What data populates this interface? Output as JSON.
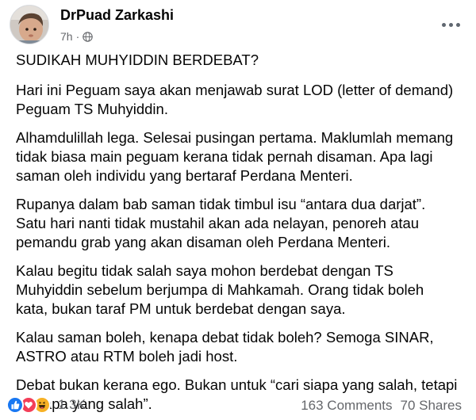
{
  "post": {
    "author": "DrPuad Zarkashi",
    "time": "7h",
    "privacy_icon": "globe-icon",
    "more_icon": "more-options-icon",
    "paragraphs": [
      "SUDIKAH MUHYIDDIN BERDEBAT?",
      "Hari ini Peguam saya akan menjawab surat LOD (letter of demand)\nPeguam TS Muhyiddin.",
      "Alhamdulillah lega. Selesai pusingan pertama. Maklumlah memang\ntidak biasa main peguam kerana tidak pernah disaman. Apa lagi\nsaman oleh individu yang bertaraf Perdana Menteri.",
      "Rupanya dalam bab saman tidak timbul isu “antara dua darjat”.\nSatu hari nanti tidak mustahil akan ada nelayan, penoreh atau\npemandu grab yang akan disaman oleh Perdana Menteri.",
      "Kalau begitu tidak salah saya mohon berdebat dengan TS\nMuhyiddin sebelum berjumpa di Mahkamah. Orang tidak boleh\nkata, bukan taraf PM untuk berdebat dengan saya.",
      "Kalau saman boleh, kenapa debat tidak boleh? Semoga SINAR,\nASTRO atau RTM boleh jadi host.",
      "Debat bukan kerana ego. Bukan untuk “cari siapa yang salah, tetapi\ncari apa yang salah”."
    ]
  },
  "footer": {
    "reaction_icons": [
      "like-icon",
      "love-icon",
      "haha-icon"
    ],
    "reaction_count": "1.3K",
    "comments": "163 Comments",
    "shares": "70 Shares"
  },
  "colors": {
    "like": "#1877f2",
    "love": "#f33e58",
    "haha": "#f7b125",
    "secondary_text": "#65676b"
  }
}
